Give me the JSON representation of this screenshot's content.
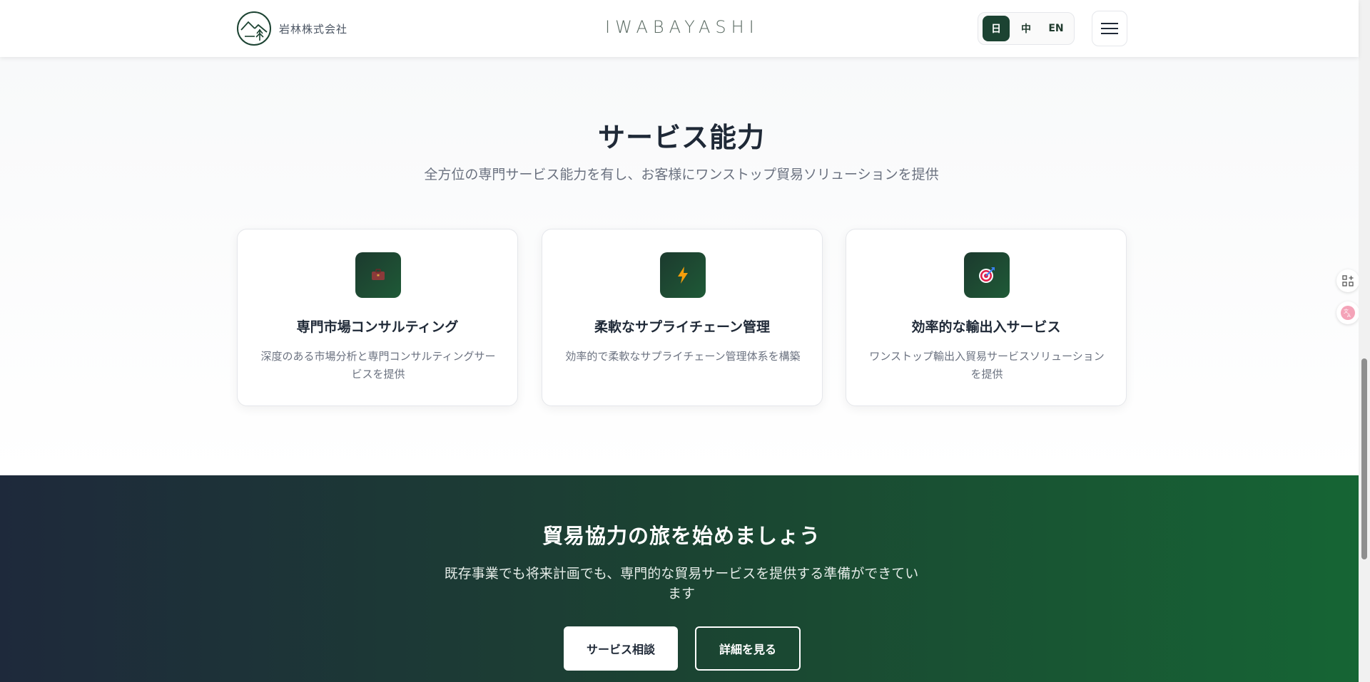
{
  "header": {
    "company_name": "岩林株式会社",
    "brand": "IWABAYASHI",
    "languages": [
      {
        "label": "日",
        "active": true
      },
      {
        "label": "中",
        "active": false
      },
      {
        "label": "EN",
        "active": false
      }
    ],
    "menu_icon": "hamburger-icon"
  },
  "services": {
    "title": "サービス能力",
    "subtitle": "全方位の専門サービス能力を有し、お客様にワンストップ貿易ソリューションを提供",
    "cards": [
      {
        "icon": "briefcase-icon",
        "title": "専門市場コンサルティング",
        "description": "深度のある市場分析と専門コンサルティングサービスを提供"
      },
      {
        "icon": "lightning-icon",
        "title": "柔軟なサプライチェーン管理",
        "description": "効率的で柔軟なサプライチェーン管理体系を構築"
      },
      {
        "icon": "target-icon",
        "title": "効率的な輸出入サービス",
        "description": "ワンストップ輸出入貿易サービスソリューションを提供"
      }
    ]
  },
  "cta": {
    "title": "貿易協力の旅を始めましょう",
    "description": "既存事業でも将来計画でも、専門的な貿易サービスを提供する準備ができています",
    "primary_button": "サービス相談",
    "secondary_button": "詳細を見る"
  },
  "colors": {
    "brand_green": "#1c4332",
    "cta_gradient_start": "#1e293b",
    "cta_gradient_end": "#166534"
  }
}
